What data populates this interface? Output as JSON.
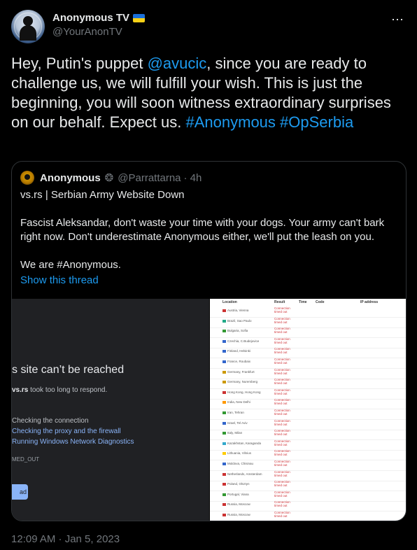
{
  "author": {
    "display_name": "Anonymous TV",
    "handle": "@YourAnonTV",
    "flag_colors": [
      "#1a6fd9",
      "#f7d117"
    ]
  },
  "more_icon": "⋯",
  "tweet": {
    "segments": [
      {
        "text": "Hey, Putin's puppet ",
        "link": false
      },
      {
        "text": "@avucic",
        "link": true
      },
      {
        "text": ", since you are ready to challenge us, we will fulfill your wish. This is just the beginning, you will soon witness extraordinary surprises on our behalf. Expect us. ",
        "link": false
      },
      {
        "text": "#Anonymous",
        "link": true
      },
      {
        "text": " ",
        "link": false
      },
      {
        "text": "#OpSerbia",
        "link": true
      }
    ]
  },
  "quote": {
    "name": "Anonymous",
    "verified_icon": "❂",
    "handle": "@Parrattarna",
    "time": "· 4h",
    "line1": "vs.rs | Serbian Army Website Down",
    "line2": "Fascist Aleksandar, don't waste your time with your dogs. Your army can't bark right now. Don't underestimate Anonymous either, we'll put the leash on you.",
    "line3": "We are #Anonymous.",
    "show_thread": "Show this thread"
  },
  "media_left": {
    "title": "s site can’t be reached",
    "sub_bold": "vs.rs",
    "sub_rest": " took too long to respond.",
    "try1": "Checking the connection",
    "try2": "Checking the proxy and the firewall",
    "try3": "Running Windows Network Diagnostics",
    "code": "MED_OUT",
    "button": "ad"
  },
  "media_right": {
    "headers": [
      "Location",
      "Result",
      "Time",
      "Code",
      "IP address"
    ],
    "result_text": "Connection timed out",
    "rows": [
      "Austria, Vienna",
      "Brazil, Sao Paulo",
      "Bulgaria, Sofia",
      "Czechia, C.Budejovice",
      "Finland, Helsinki",
      "France, Roubaix",
      "Germany, Frankfurt",
      "Germany, Nuremberg",
      "Hong Kong, Hong Kong",
      "India, New Delhi",
      "Iran, Tehran",
      "Israel, Tel Aviv",
      "Italy, Milan",
      "Kazakhstan, Karaganda",
      "Lithuania, Vilnius",
      "Moldova, Chisinau",
      "Netherlands, Amsterdam",
      "Poland, Olsztyn",
      "Portugal, Viana",
      "Russia, Moscow",
      "Russia, Moscow"
    ]
  },
  "timestamp": "12:09 AM · Jan 5, 2023"
}
